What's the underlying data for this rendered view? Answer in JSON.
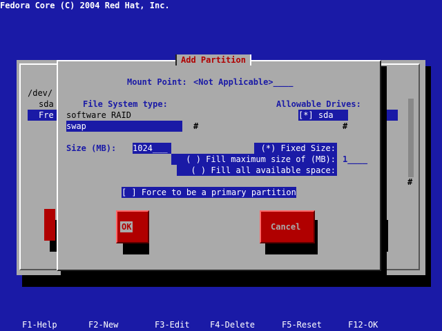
{
  "window_title": "Fedora Core (C) 2004 Red Hat, Inc.",
  "background_window": {
    "device_label": "/dev/",
    "rows": [
      "sda",
      "Fre"
    ]
  },
  "dialog": {
    "title": "Add Partition",
    "mount_point_label": "Mount Point:",
    "mount_point_value": "<Not Applicable>____",
    "fs_type_label": "File System type:",
    "fs_types": [
      "software RAID",
      "swap"
    ],
    "allowable_drives_label": "Allowable Drives:",
    "drives": [
      "[*] sda"
    ],
    "size_label": "Size (MB):",
    "size_value": "1024___",
    "options": [
      "(*) Fixed Size:",
      "( ) Fill maximum size of (MB):",
      "( ) Fill all available space:"
    ],
    "max_size_value": "1____",
    "primary_checkbox": "[ ] Force to be a primary partition",
    "ok_label": "OK",
    "cancel_label": "Cancel"
  },
  "footer": {
    "keys": [
      "F1-Help",
      "F2-New",
      "F3-Edit",
      "F4-Delete",
      "F5-Reset",
      "F12-OK"
    ]
  },
  "colors": {
    "background": "#1a1aa6",
    "dialog": "#aaaaaa",
    "button": "#b00000",
    "selection": "#1a1aa6"
  }
}
